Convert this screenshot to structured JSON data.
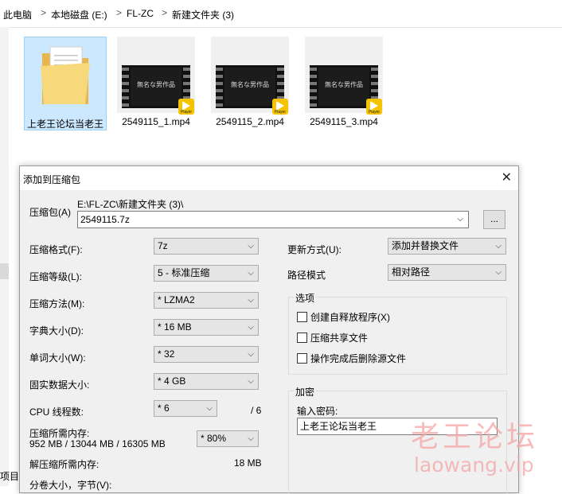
{
  "breadcrumb": [
    "此电脑",
    "本地磁盘 (E:)",
    "FL-ZC",
    "新建文件夹 (3)"
  ],
  "breadcrumb_separator": ">",
  "files": [
    {
      "name": "上老王论坛当老王",
      "type": "folder",
      "selected": true
    },
    {
      "name": "2549115_1.mp4",
      "type": "video",
      "thumb_text": "無名な男作品",
      "badge": "Player"
    },
    {
      "name": "2549115_2.mp4",
      "type": "video",
      "thumb_text": "無名な男作品",
      "badge": "Player"
    },
    {
      "name": "2549115_3.mp4",
      "type": "video",
      "thumb_text": "無名な男作品",
      "badge": "Player"
    }
  ],
  "left_edge_text": "项目",
  "dialog": {
    "title": "添加到压缩包",
    "close_symbol": "✕",
    "archive_label": "压缩包(A)",
    "archive_path": "E:\\FL-ZC\\新建文件夹 (3)\\",
    "archive_name": "2549115.7z",
    "browse_label": "...",
    "format_label": "压缩格式(F):",
    "format_value": "7z",
    "level_label": "压缩等级(L):",
    "level_value": "5 - 标准压缩",
    "method_label": "压缩方法(M):",
    "method_value": "*  LZMA2",
    "dict_label": "字典大小(D):",
    "dict_value": "*  16 MB",
    "word_label": "单词大小(W):",
    "word_value": "*  32",
    "solid_label": "固实数据大小:",
    "solid_value": "*  4 GB",
    "threads_label": "CPU 线程数:",
    "threads_value": "*  6",
    "threads_total": "/ 6",
    "mem_label": "压缩所需内存:",
    "mem_detail": "952 MB / 13044 MB / 16305 MB",
    "mem_value": "* 80%",
    "decomp_label": "解压缩所需内存:",
    "decomp_value": "18 MB",
    "split_label": "分卷大小，字节(V):",
    "update_label": "更新方式(U):",
    "update_value": "添加并替换文件",
    "pathmode_label": "路径模式",
    "pathmode_value": "相对路径",
    "options_title": "选项",
    "options": [
      "创建自释放程序(X)",
      "压缩共享文件",
      "操作完成后删除源文件"
    ],
    "encrypt_title": "加密",
    "password_label": "输入密码:",
    "password_value": "上老王论坛当老王"
  },
  "watermark": {
    "cn": "老王论坛",
    "en": "laowang.vip"
  },
  "colors": {
    "selection": "#cce8ff",
    "dialog_bg": "#f0f0f0",
    "watermark": "#f6a5a5"
  }
}
